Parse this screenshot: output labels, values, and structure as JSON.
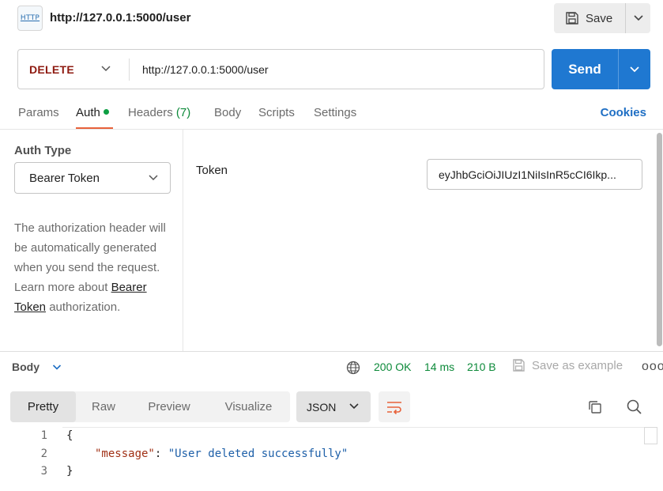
{
  "header": {
    "icon_text": "HTTP",
    "title": "http://127.0.0.1:5000/user",
    "save_label": "Save"
  },
  "request": {
    "method": "DELETE",
    "url": "http://127.0.0.1:5000/user",
    "send_label": "Send"
  },
  "tabs": {
    "params": "Params",
    "auth": "Auth",
    "headers": "Headers",
    "headers_count": "(7)",
    "body": "Body",
    "scripts": "Scripts",
    "settings": "Settings",
    "cookies": "Cookies"
  },
  "auth": {
    "type_label": "Auth Type",
    "type_value": "Bearer Token",
    "desc_pre": "The authorization header will be automatically generated when you send the request. Learn more about ",
    "desc_link": "Bearer Token",
    "desc_post": " authorization.",
    "token_label": "Token",
    "token_value": "eyJhbGciOiJIUzI1NiIsInR5cCI6Ikp..."
  },
  "response": {
    "body_label": "Body",
    "status": "200 OK",
    "time": "14 ms",
    "size": "210 B",
    "save_example": "Save as example",
    "more": "ooo",
    "views": [
      "Pretty",
      "Raw",
      "Preview",
      "Visualize"
    ],
    "format": "JSON",
    "lines": [
      {
        "num": "1",
        "text": "{"
      },
      {
        "num": "2",
        "key": "\"message\"",
        "sep": ": ",
        "value": "\"User deleted successfully\""
      },
      {
        "num": "3",
        "text": "}"
      }
    ]
  },
  "colors": {
    "method": "#8e1a10",
    "send": "#1f78d1",
    "status_ok": "#0d8a3a",
    "active_tab": "#e8623b"
  }
}
